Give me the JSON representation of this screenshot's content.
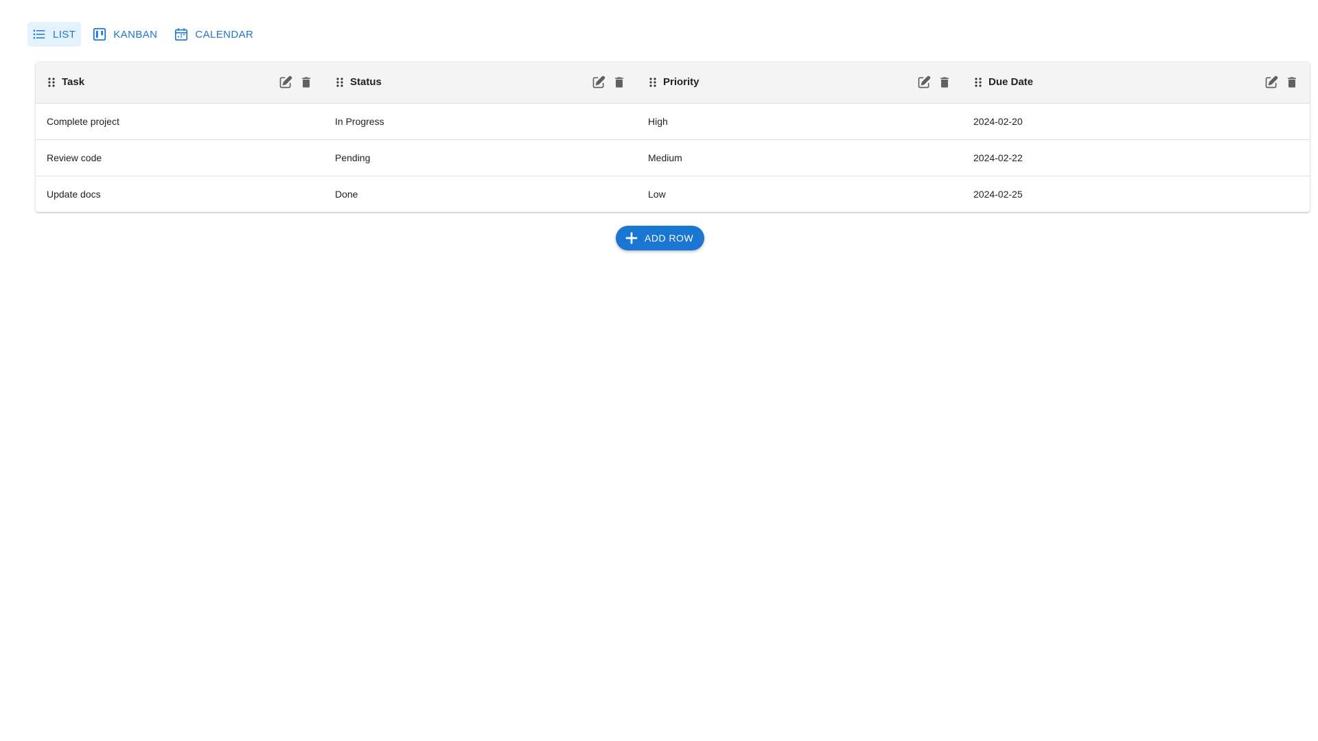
{
  "view_tabs": [
    {
      "label": "LIST",
      "icon": "list-icon",
      "active": true
    },
    {
      "label": "KANBAN",
      "icon": "kanban-icon",
      "active": false
    },
    {
      "label": "CALENDAR",
      "icon": "calendar-icon",
      "active": false
    }
  ],
  "table": {
    "columns": [
      {
        "label": "Task"
      },
      {
        "label": "Status"
      },
      {
        "label": "Priority"
      },
      {
        "label": "Due Date"
      }
    ],
    "rows": [
      [
        "Complete project",
        "In Progress",
        "High",
        "2024-02-20"
      ],
      [
        "Review code",
        "Pending",
        "Medium",
        "2024-02-22"
      ],
      [
        "Update docs",
        "Done",
        "Low",
        "2024-02-25"
      ]
    ],
    "column_icons": {
      "drag": "drag-handle-icon",
      "edit": "edit-icon",
      "delete": "delete-icon"
    }
  },
  "add_row": {
    "label": "ADD ROW",
    "icon": "plus-icon"
  },
  "colors": {
    "accent": "#1976d2",
    "active_tab_bg": "#e3f2fd",
    "header_bg": "#f4f4f4",
    "icon_gray": "#616161"
  }
}
